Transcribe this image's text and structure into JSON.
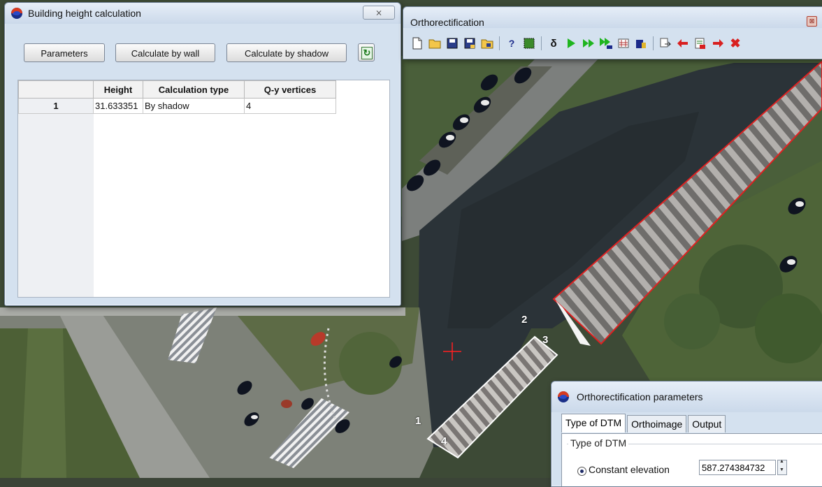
{
  "building_window": {
    "title": "Building height calculation",
    "close_glyph": "⨯",
    "buttons": {
      "parameters": "Parameters",
      "by_wall": "Calculate by wall",
      "by_shadow": "Calculate by shadow",
      "refresh_icon": "refresh-icon"
    },
    "table": {
      "headers": [
        "",
        "Height",
        "Calculation type",
        "Q-y  vertices"
      ],
      "rows": [
        {
          "index": "1",
          "height": "31.633351",
          "type": "By shadow",
          "vertices": "4"
        }
      ]
    }
  },
  "ortho_window": {
    "title": "Orthorectification",
    "close_glyph": "⊠",
    "toolbar": [
      "new-icon",
      "open-icon",
      "save-icon",
      "save-as-icon",
      "load-icon",
      "help-icon",
      "fill-icon",
      "delta-icon",
      "play-icon",
      "fast-forward-icon",
      "multi-run-icon",
      "settings-icon",
      "building-icon",
      "export-icon",
      "arrow-left-icon",
      "batch-icon",
      "arrow-right-icon",
      "delete-icon"
    ]
  },
  "params_window": {
    "title": "Orthorectification parameters",
    "tabs": [
      "Type of DTM",
      "Orthoimage",
      "Output"
    ],
    "active_tab": "Type of DTM",
    "group_title": "Type of DTM",
    "option_label": "Constant elevation",
    "elevation_value": "587.274384732"
  },
  "map": {
    "vertex_labels": [
      "1",
      "2",
      "3",
      "4"
    ],
    "colors": {
      "outline_red": "#e02020",
      "outline_white": "#ffffff",
      "crosshair": "#ff2020"
    }
  }
}
